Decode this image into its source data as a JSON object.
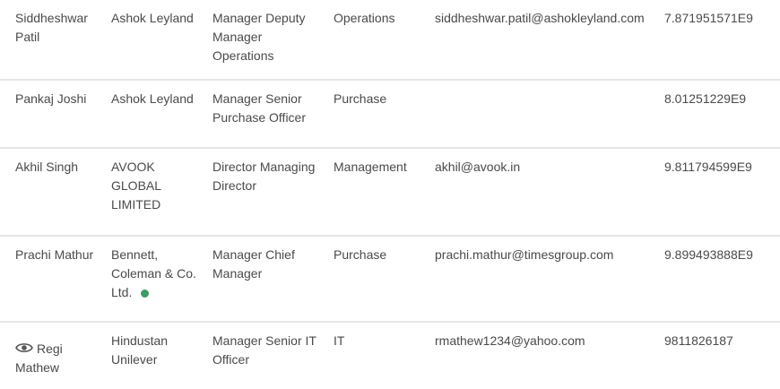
{
  "rows": [
    {
      "name": "Siddheshwar Patil",
      "company": "Ashok Leyland",
      "title": "Manager Deputy Manager Operations",
      "department": "Operations",
      "email": "siddheshwar.patil@ashokleyland.com",
      "phone": "7.871951571E9"
    },
    {
      "name": "Pankaj Joshi",
      "company": "Ashok Leyland",
      "title": "Manager Senior Purchase Officer",
      "department": "Purchase",
      "email": "",
      "phone": "8.01251229E9"
    },
    {
      "name": "Akhil Singh",
      "company": "AVOOK GLOBAL LIMITED",
      "title": "Director Managing Director",
      "department": "Management",
      "email": "akhil@avook.in",
      "phone": "9.811794599E9"
    },
    {
      "name": "Prachi Mathur",
      "company": "Bennett, Coleman & Co. Ltd.",
      "title": "Manager Chief Manager",
      "department": "Purchase",
      "email": "prachi.mathur@timesgroup.com",
      "phone": "9.899493888E9"
    },
    {
      "name": "Regi Mathew",
      "company": "Hindustan Unilever",
      "title": "Manager Senior IT Officer",
      "department": "IT",
      "email": "rmathew1234@yahoo.com",
      "phone": "9811826187"
    }
  ],
  "icons": {
    "row4_status": "status-dot-icon",
    "row5_view": "eye-icon"
  },
  "colors": {
    "text": "#4a4a4a",
    "divider": "#e6e6e6",
    "status_dot": "#3d9a64"
  }
}
